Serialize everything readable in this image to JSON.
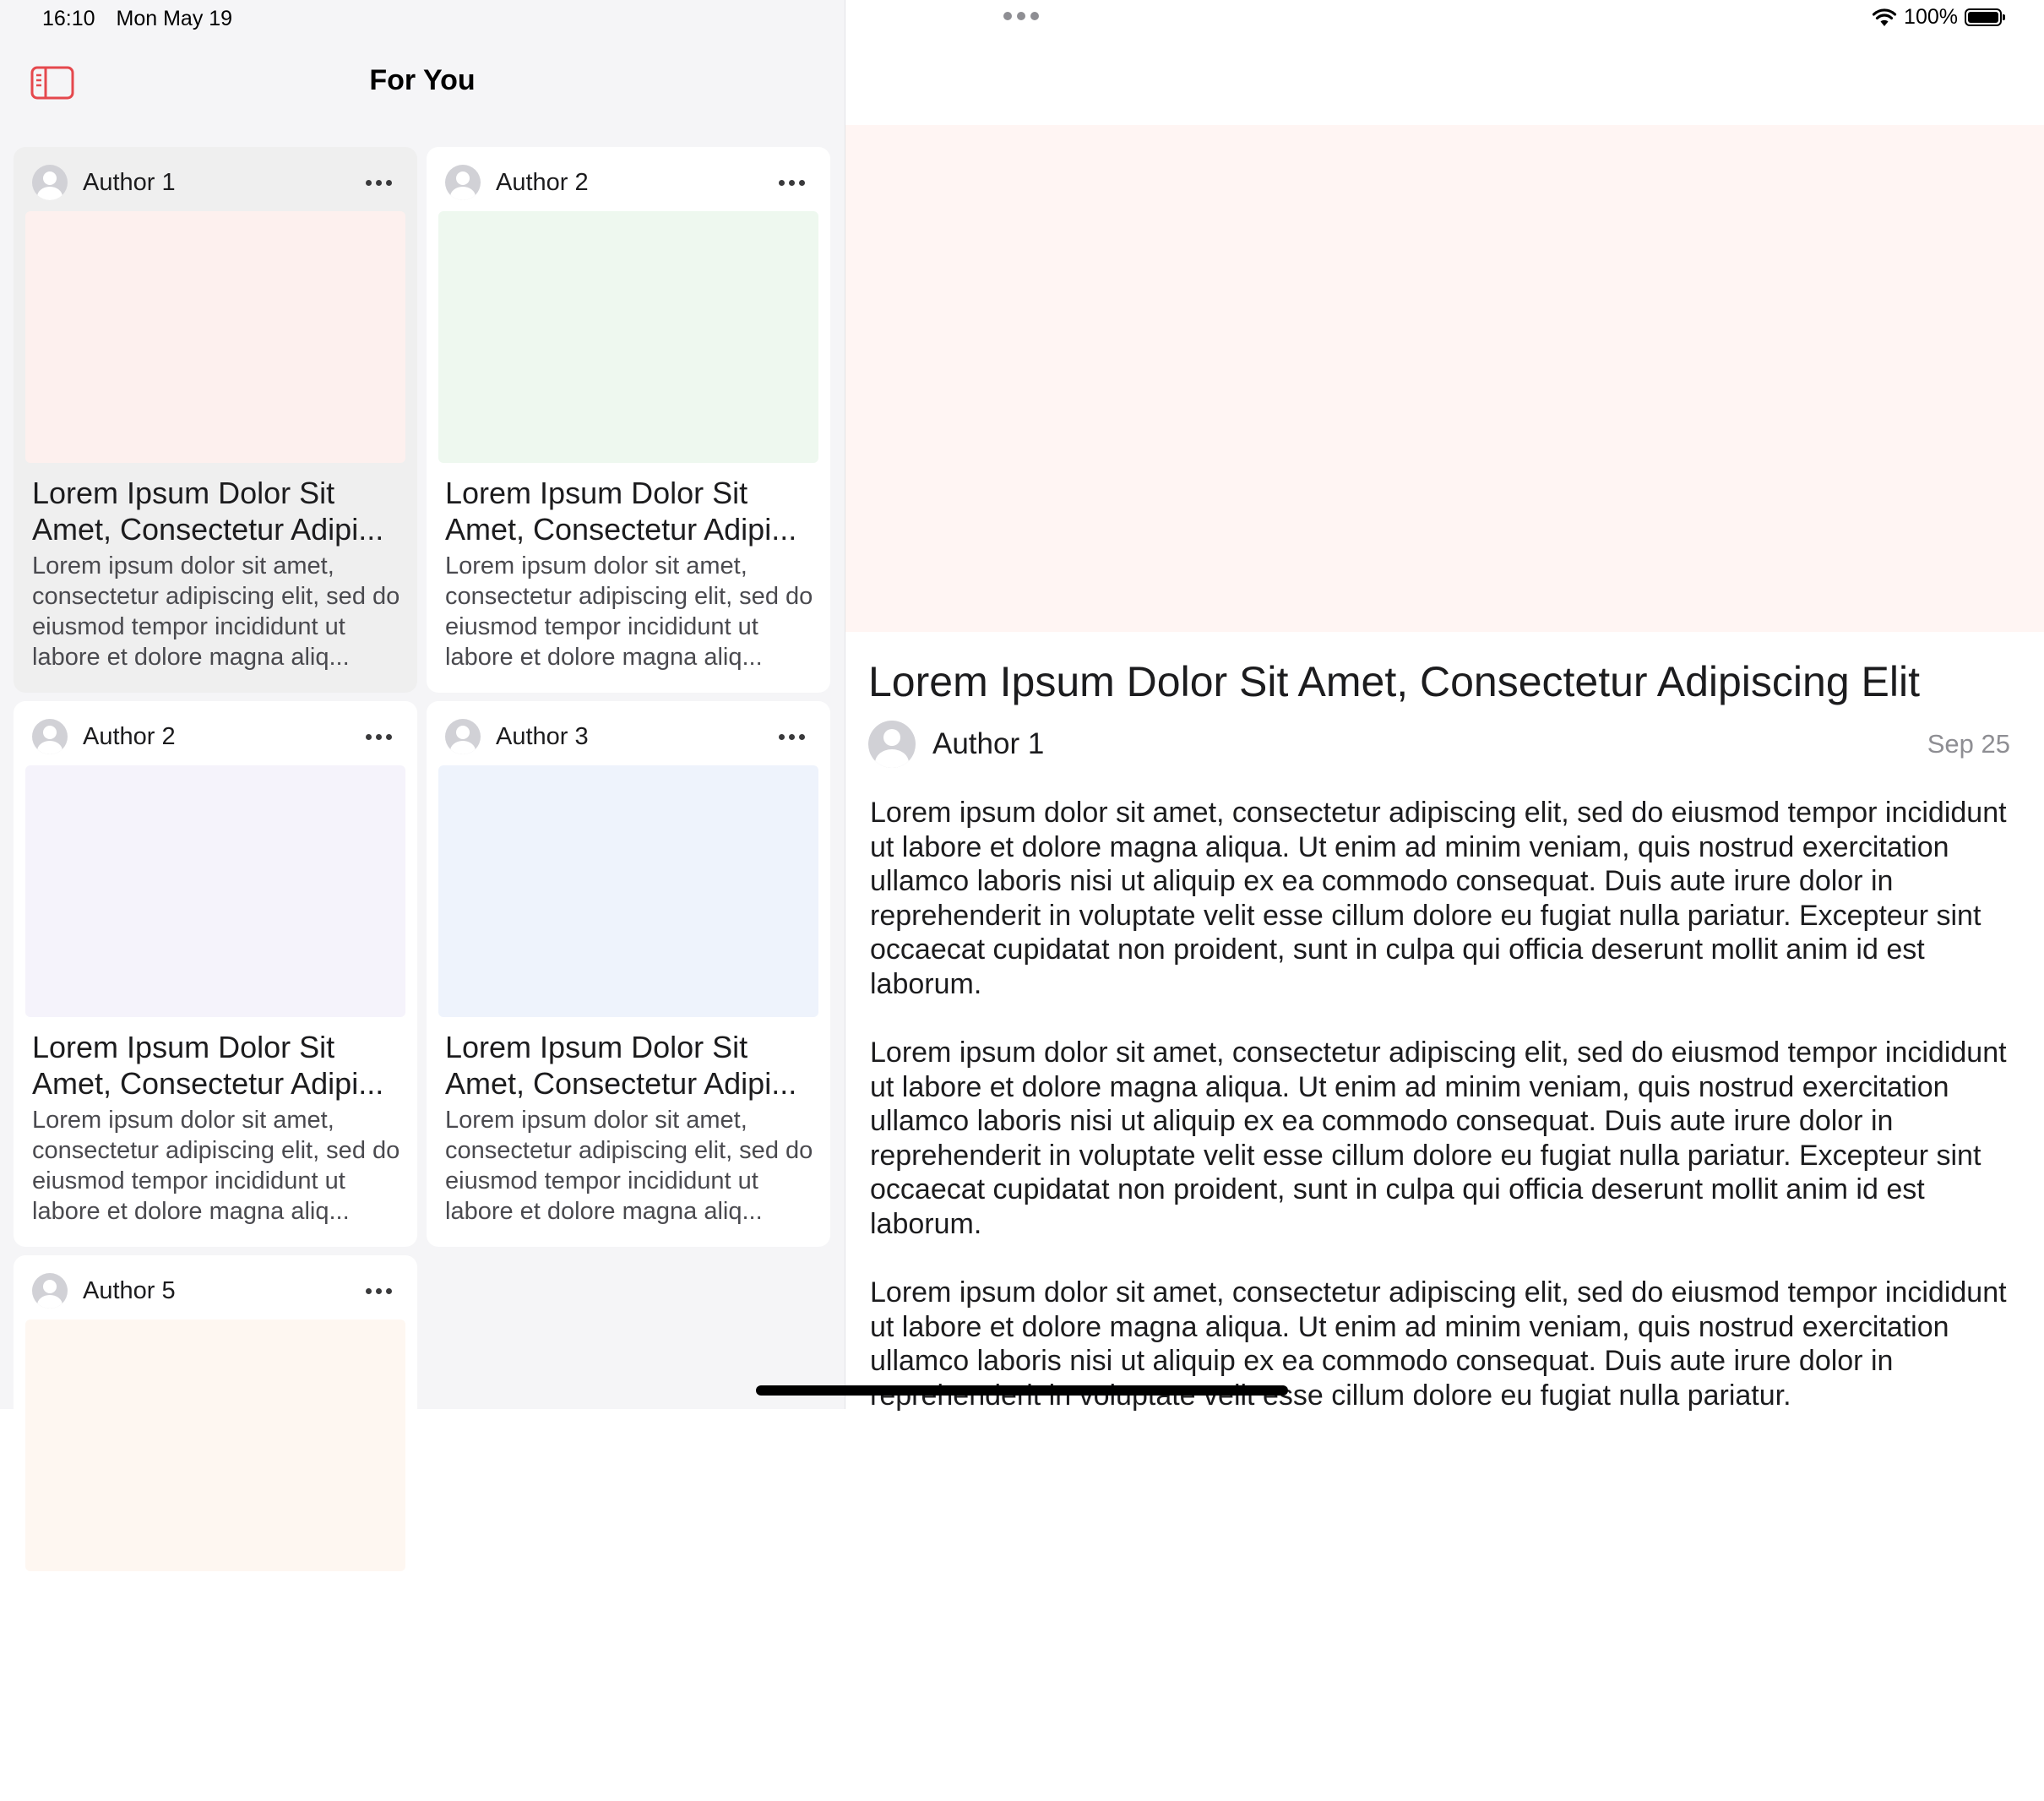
{
  "status_bar": {
    "time": "16:10",
    "date": "Mon May 19",
    "battery": "100%",
    "battery_level": 1.0
  },
  "sidebar": {
    "title": "For You",
    "cards": [
      {
        "author": "Author 1",
        "title": "Lorem Ipsum Dolor Sit Amet, Consectetur Adipi...",
        "excerpt": "Lorem ipsum dolor sit amet, consectetur adipiscing elit, sed do eiusmod tempor incididunt ut labore et dolore magna aliq...",
        "image_color": "#fdf0ee",
        "selected": true
      },
      {
        "author": "Author 2",
        "title": "Lorem Ipsum Dolor Sit Amet, Consectetur Adipi...",
        "excerpt": "Lorem ipsum dolor sit amet, consectetur adipiscing elit, sed do eiusmod tempor incididunt ut labore et dolore magna aliq...",
        "image_color": "#eef8ef",
        "selected": false
      },
      {
        "author": "Author 2",
        "title": "Lorem Ipsum Dolor Sit Amet, Consectetur Adipi...",
        "excerpt": "Lorem ipsum dolor sit amet, consectetur adipiscing elit, sed do eiusmod tempor incididunt ut labore et dolore magna aliq...",
        "image_color": "#f5f3fb",
        "selected": false
      },
      {
        "author": "Author 3",
        "title": "Lorem Ipsum Dolor Sit Amet, Consectetur Adipi...",
        "excerpt": "Lorem ipsum dolor sit amet, consectetur adipiscing elit, sed do eiusmod tempor incididunt ut labore et dolore magna aliq...",
        "image_color": "#eef3fc",
        "selected": false
      },
      {
        "author": "Author 5",
        "title": "",
        "excerpt": "",
        "image_color": "#fef7f1",
        "selected": false
      }
    ]
  },
  "detail": {
    "hero_color": "#fff5f3",
    "title": "Lorem Ipsum Dolor Sit Amet, Consectetur Adipiscing Elit",
    "author": "Author 1",
    "date": "Sep 25",
    "paragraphs": [
      "Lorem ipsum dolor sit amet, consectetur adipiscing elit, sed do eiusmod tempor incididunt ut labore et dolore magna aliqua. Ut enim ad minim veniam, quis nostrud exercitation ullamco laboris nisi ut aliquip ex ea commodo consequat. Duis aute irure dolor in reprehenderit in voluptate velit esse cillum dolore eu fugiat nulla pariatur. Excepteur sint occaecat cupidatat non proident, sunt in culpa qui officia deserunt mollit anim id est laborum.",
      "Lorem ipsum dolor sit amet, consectetur adipiscing elit, sed do eiusmod tempor incididunt ut labore et dolore magna aliqua. Ut enim ad minim veniam, quis nostrud exercitation ullamco laboris nisi ut aliquip ex ea commodo consequat. Duis aute irure dolor in reprehenderit in voluptate velit esse cillum dolore eu fugiat nulla pariatur. Excepteur sint occaecat cupidatat non proident, sunt in culpa qui officia deserunt mollit anim id est laborum.",
      "Lorem ipsum dolor sit amet, consectetur adipiscing elit, sed do eiusmod tempor incididunt ut labore et dolore magna aliqua. Ut enim ad minim veniam, quis nostrud exercitation ullamco laboris nisi ut aliquip ex ea commodo consequat. Duis aute irure dolor in reprehenderit in voluptate velit esse cillum dolore eu fugiat nulla pariatur."
    ]
  },
  "icons": {
    "sidebar_toggle": "sidebar-toggle-icon",
    "more": "ellipsis-icon",
    "avatar": "person-circle-icon",
    "wifi": "wifi-icon",
    "battery": "battery-icon",
    "multitask": "multitasking-dots-icon"
  },
  "colors": {
    "accent": "#e5484d",
    "secondary_text": "#8e8e93"
  }
}
